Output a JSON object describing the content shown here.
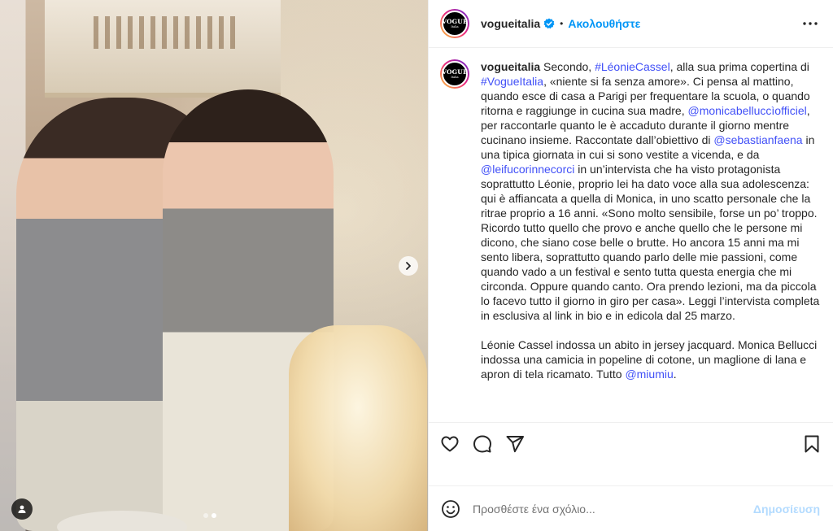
{
  "post": {
    "carousel_dots": 2,
    "active_dot": 1
  },
  "header": {
    "avatar_logo": "VOGUE",
    "avatar_sub": "Italia",
    "username": "vogueitalia",
    "separator": "•",
    "follow_label": "Ακολουθήστε",
    "verified_icon": "verified-badge-icon",
    "more_icon": "more-options-icon"
  },
  "caption": {
    "username": "vogueitalia",
    "t1": " Secondo, ",
    "tag_leonie": "#LéonieCassel",
    "t2": ", alla sua prima copertina di ",
    "tag_vogue": "#VogueItalia",
    "t3": ", «niente si fa senza amore». Ci pensa al mattino, quando esce di casa a Parigi per frequentare la scuola, o quando ritorna e raggiunge in cucina sua madre, ",
    "mention_monica": "@monicabelluccìofficiel",
    "t4": ", per raccontarle quanto le è accaduto durante il giorno mentre cucinano insieme. Raccontate dall’obiettivo di ",
    "mention_seb": "@sebastianfaena",
    "t5": " in una tipica giornata in cui si sono vestite a vicenda, e da ",
    "mention_leifu": "@leifucorinnecorci",
    "t6": " in un’intervista che ha visto protagonista soprattutto Léonie, proprio lei ha dato voce alla sua adolescenza: qui è affiancata a quella di Monica, in uno scatto personale che la ritrae proprio a 16 anni. «Sono molto sensibile, forse un po’ troppo. Ricordo tutto quello che provo e anche quello che le persone mi dicono, che siano cose belle o brutte. Ho ancora 15 anni ma mi sento libera, soprattutto quando parlo delle mie passioni, come quando vado a un festival e sento tutta questa energia che mi circonda. Oppure quando canto. Ora prendo lezioni, ma da piccola lo facevo tutto il giorno in giro per casa». Leggi l’intervista completa in esclusiva al link in bio e in edicola dal 25 marzo.",
    "t7": "Léonie Cassel indossa un abito in jersey jacquard. Monica Bellucci indossa una camicia in popeline di cotone, un maglione di lana e apron di tela ricamato. Tutto ",
    "mention_miumiu": "@miumiu",
    "t8": "."
  },
  "actions": {
    "like_icon": "heart-icon",
    "comment_icon": "comment-icon",
    "share_icon": "share-icon",
    "save_icon": "bookmark-icon"
  },
  "comment": {
    "placeholder": "Προσθέστε ένα σχόλιο...",
    "publish_label": "Δημοσίευση",
    "emoji_icon": "emoji-icon"
  },
  "colors": {
    "link_blue": "#0095f6",
    "tag_blue": "#4150f7",
    "publish_disabled": "#b3dbff",
    "text": "#262626"
  }
}
